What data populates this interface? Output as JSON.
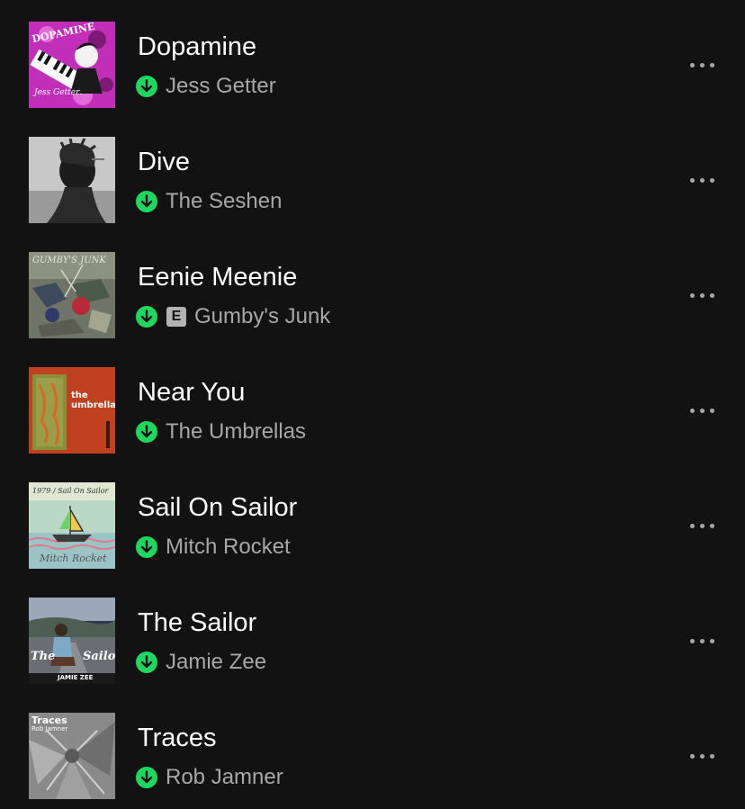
{
  "colors": {
    "background": "#121212",
    "title": "#ffffff",
    "artist": "#a7a7a7",
    "download_accent": "#1ed760",
    "explicit_badge": "#b3b3b3"
  },
  "icons": {
    "download": "download-arrow-circle-icon",
    "more": "more-options-ellipsis-icon",
    "explicit": "explicit-badge"
  },
  "tracks": [
    {
      "title": "Dopamine",
      "artist": "Jess Getter",
      "explicit": false,
      "downloaded": true,
      "art_text": [
        "DOPAMINE",
        "Jess Getter"
      ]
    },
    {
      "title": "Dive",
      "artist": "The Seshen",
      "explicit": false,
      "downloaded": true,
      "art_text": []
    },
    {
      "title": "Eenie Meenie",
      "artist": "Gumby's Junk",
      "explicit": true,
      "explicit_label": "E",
      "downloaded": true,
      "art_text": [
        "GUMBY'S JUNK"
      ]
    },
    {
      "title": "Near You",
      "artist": "The Umbrellas",
      "explicit": false,
      "downloaded": true,
      "art_text": [
        "the",
        "umbrellas"
      ]
    },
    {
      "title": "Sail On Sailor",
      "artist": "Mitch Rocket",
      "explicit": false,
      "downloaded": true,
      "art_text": [
        "1979 / Sail On Sailor",
        "Mitch Rocket"
      ]
    },
    {
      "title": "The Sailor",
      "artist": "Jamie Zee",
      "explicit": false,
      "downloaded": true,
      "art_text": [
        "The",
        "Sailor",
        "JAMIE ZEE"
      ]
    },
    {
      "title": "Traces",
      "artist": "Rob Jamner",
      "explicit": false,
      "downloaded": true,
      "art_text": [
        "Traces",
        "Rob Jamner"
      ]
    }
  ]
}
